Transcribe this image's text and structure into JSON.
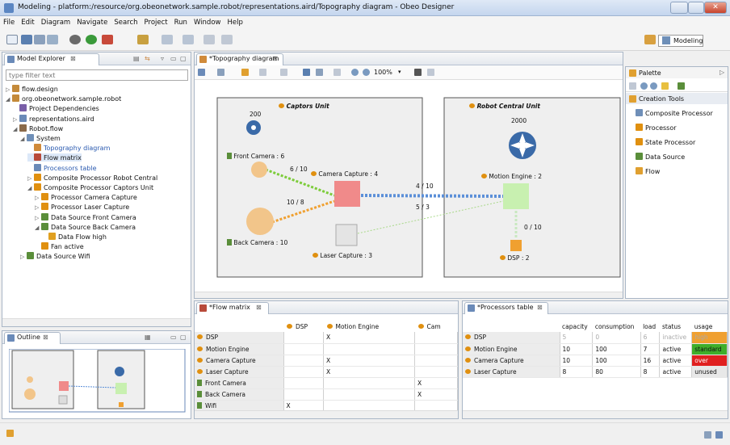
{
  "window": {
    "title": "Modeling - platform:/resource/org.obeonetwork.sample.robot/representations.aird/Topography diagram - Obeo Designer"
  },
  "menu": [
    "File",
    "Edit",
    "Diagram",
    "Navigate",
    "Search",
    "Project",
    "Run",
    "Window",
    "Help"
  ],
  "perspective": {
    "label": "Modeling"
  },
  "explorer": {
    "tab": "Model Explorer",
    "filter_placeholder": "type filter text",
    "items": [
      {
        "label": "flow.design",
        "indent": 0,
        "arrow": "▷",
        "color": "#c48a3a"
      },
      {
        "label": "org.obeonetwork.sample.robot",
        "indent": 0,
        "arrow": "◢",
        "color": "#c48a3a"
      },
      {
        "label": "Project Dependencies",
        "indent": 1,
        "arrow": "",
        "color": "#7a5fa8"
      },
      {
        "label": "representations.aird",
        "indent": 1,
        "arrow": "▷",
        "color": "#6a8ab8"
      },
      {
        "label": "Robot.flow",
        "indent": 1,
        "arrow": "◢",
        "color": "#8a6a4a"
      },
      {
        "label": "System",
        "indent": 2,
        "arrow": "◢",
        "color": "#6f8fb8"
      },
      {
        "label": "Topography diagram",
        "indent": 3,
        "arrow": "",
        "color": "#d08a3a",
        "link": true
      },
      {
        "label": "Flow matrix",
        "indent": 3,
        "arrow": "",
        "color": "#b84a3a",
        "selected": true
      },
      {
        "label": "Processors table",
        "indent": 3,
        "arrow": "",
        "color": "#6a8ab8",
        "link": true
      },
      {
        "label": "Composite Processor Robot Central",
        "indent": 3,
        "arrow": "▷",
        "color": "#e09010"
      },
      {
        "label": "Composite Processor Captors Unit",
        "indent": 3,
        "arrow": "◢",
        "color": "#e09010"
      },
      {
        "label": "Processor Camera Capture",
        "indent": 4,
        "arrow": "▷",
        "color": "#e09010"
      },
      {
        "label": "Processor Laser Capture",
        "indent": 4,
        "arrow": "▷",
        "color": "#e09010"
      },
      {
        "label": "Data Source Front Camera",
        "indent": 4,
        "arrow": "▷",
        "color": "#5a8e3a"
      },
      {
        "label": "Data Source Back Camera",
        "indent": 4,
        "arrow": "◢",
        "color": "#5a8e3a"
      },
      {
        "label": "Data Flow high",
        "indent": 5,
        "arrow": "",
        "color": "#e0a020"
      },
      {
        "label": "Fan active",
        "indent": 4,
        "arrow": "",
        "color": "#e09010"
      },
      {
        "label": "Data Source Wifi",
        "indent": 2,
        "arrow": "▷",
        "color": "#5a8e3a"
      }
    ]
  },
  "outline": {
    "tab": "Outline"
  },
  "editor": {
    "tab": "*Topography diagram",
    "zoom": "100%",
    "captors": {
      "title": "Captors Unit",
      "fan_value": "200",
      "front_camera": "Front Camera : 6",
      "back_camera": "Back Camera : 10",
      "camera_capture": "Camera Capture : 4",
      "laser_capture": "Laser Capture : 3",
      "edge_front": "6 / 10",
      "edge_back": "10 / 8"
    },
    "central": {
      "title": "Robot Central Unit",
      "fan_value": "2000",
      "motion_engine": "Motion Engine : 2",
      "dsp": "DSP : 2",
      "edge_dsp": "0 / 10"
    },
    "edge_camera_motion": "4 / 10",
    "edge_laser_motion": "5 / 3"
  },
  "palette": {
    "title": "Palette",
    "group": "Creation Tools",
    "tools": [
      "Composite Processor",
      "Processor",
      "State Processor",
      "Data Source",
      "Flow"
    ]
  },
  "flow_matrix": {
    "tab": "*Flow matrix",
    "columns": [
      "DSP",
      "Motion Engine",
      "Cam"
    ],
    "rows": [
      {
        "name": "DSP",
        "cells": [
          "",
          "X",
          ""
        ]
      },
      {
        "name": "Motion Engine",
        "cells": [
          "",
          "",
          ""
        ]
      },
      {
        "name": "Camera Capture",
        "cells": [
          "",
          "X",
          ""
        ]
      },
      {
        "name": "Laser Capture",
        "cells": [
          "",
          "X",
          ""
        ]
      },
      {
        "name": "Front Camera",
        "cells": [
          "",
          "",
          "X"
        ]
      },
      {
        "name": "Back Camera",
        "cells": [
          "",
          "",
          "X"
        ]
      },
      {
        "name": "Wifi",
        "cells": [
          "X",
          "",
          ""
        ]
      }
    ]
  },
  "processors_table": {
    "tab": "*Processors table",
    "columns": [
      "capacity",
      "consumption",
      "load",
      "status",
      "usage"
    ],
    "rows": [
      {
        "name": "DSP",
        "capacity": "5",
        "consumption": "0",
        "load": "6",
        "status": "inactive",
        "usage": "high",
        "usage_color": "#f0a030",
        "dim": true
      },
      {
        "name": "Motion Engine",
        "capacity": "10",
        "consumption": "100",
        "load": "7",
        "status": "active",
        "usage": "standard",
        "usage_color": "#3fae2a"
      },
      {
        "name": "Camera Capture",
        "capacity": "10",
        "consumption": "100",
        "load": "16",
        "status": "active",
        "usage": "over",
        "usage_color": "#e02020"
      },
      {
        "name": "Laser Capture",
        "capacity": "8",
        "consumption": "80",
        "load": "8",
        "status": "active",
        "usage": "unused",
        "usage_color": "#e8e8e8"
      }
    ]
  }
}
